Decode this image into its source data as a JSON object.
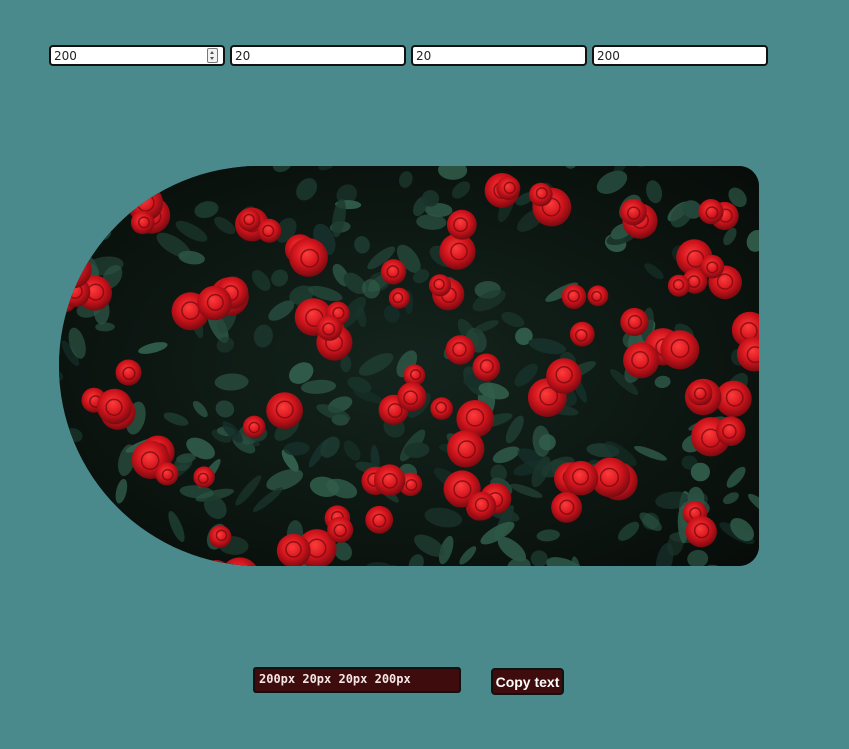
{
  "radius_inputs": [
    {
      "value": "200"
    },
    {
      "value": "20"
    },
    {
      "value": "20"
    },
    {
      "value": "200"
    }
  ],
  "preview": {
    "image_subject": "red-roses-bush",
    "flower_color": "#c8141c",
    "leaf_color": "#1f3a30"
  },
  "output": {
    "css_value": "200px 20px 20px 200px"
  },
  "copy_button": {
    "label": "Copy text"
  },
  "colors": {
    "background": "#4a8a8c",
    "output_bg": "#3e0c0c",
    "button_bg": "#3e0c0c"
  }
}
